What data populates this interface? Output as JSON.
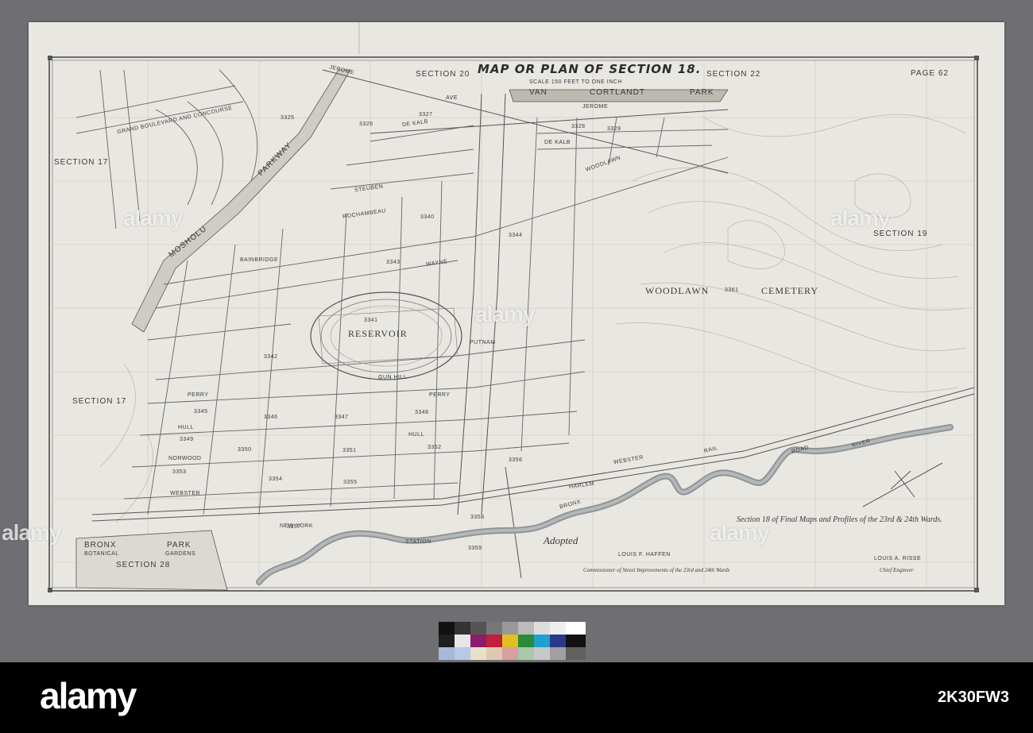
{
  "map": {
    "title": "MAP OR PLAN OF SECTION 18.",
    "scale": "SCALE 150 FEET TO ONE INCH",
    "page": "PAGE 62",
    "sections": {
      "s20": "SECTION 20",
      "s22": "SECTION 22",
      "s17_top": "SECTION 17",
      "s17_mid": "SECTION 17",
      "s19": "SECTION 19",
      "s28": "SECTION 28"
    },
    "places": {
      "van": "VAN",
      "cortlandt": "CORTLANDT",
      "park": "PARK",
      "woodlawn": "WOODLAWN",
      "cemetery": "CEMETERY",
      "reservoir": "RESERVOIR",
      "parkway": "PARKWAY",
      "mosholu": "MOSHOLU",
      "grand_boulevard": "GRAND BOULEVARD AND CONCOURSE",
      "bronx": "BRONX",
      "bronx_park": "PARK",
      "botanical": "BOTANICAL",
      "gardens": "GARDENS",
      "river": "RIVER",
      "bronx_river": "BRONX"
    },
    "streets": {
      "jerome": "JEROME",
      "ave": "AVE",
      "de_kalb": "DE KALB",
      "woodlawn_rd": "WOODLAWN",
      "steuben": "STEUBEN",
      "perry": "PERRY",
      "hull": "HULL",
      "norwood": "NORWOOD",
      "webster": "WEBSTER",
      "harlem": "HARLEM",
      "new_york": "NEW YORK",
      "station": "STATION",
      "bainbridge": "BAINBRIDGE",
      "putnam": "PUTNAM",
      "wayne": "WAYNE",
      "rochambeau": "ROCHAMBEAU",
      "gun_hill": "GUN HILL",
      "rail": "RAIL",
      "road": "ROAD"
    },
    "blocks": [
      "3325",
      "3326",
      "3327",
      "3328",
      "3329",
      "3340",
      "3341",
      "3342",
      "3343",
      "3344",
      "3345",
      "3346",
      "3347",
      "3348",
      "3349",
      "3350",
      "3351",
      "3352",
      "3353",
      "3354",
      "3355",
      "3356",
      "3357",
      "3358",
      "3359",
      "3361"
    ],
    "captions": {
      "section_caption": "Section 18 of Final Maps and Profiles of the 23rd & 24th Wards.",
      "adopted": "Adopted",
      "commissioner_name": "LOUIS F. HAFFEN",
      "commissioner_title": "Commissioner of Street Improvements of the 23rd and 24th Wards",
      "engineer_name": "LOUIS A. RISSE",
      "engineer_title": "Chief Engineer"
    }
  },
  "watermark": {
    "text": "alamy",
    "image_id": "2K30FW3"
  },
  "colors": {
    "background": "#6f6e73",
    "paper": "#e9e7e1",
    "ink": "#3a3a3a",
    "river": "#8f9497"
  }
}
